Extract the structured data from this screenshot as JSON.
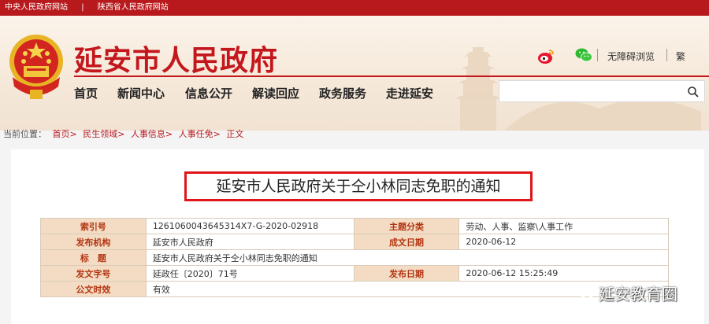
{
  "topbar": {
    "link1": "中央人民政府网站",
    "separator": "|",
    "link2": "陕西省人民政府网站"
  },
  "header": {
    "title": "延安市人民政府",
    "icons": [
      "weibo-icon",
      "wechat-icon"
    ],
    "accessibility": "无障碍浏览",
    "traditional": "繁"
  },
  "nav": [
    "首页",
    "新闻中心",
    "信息公开",
    "解读回应",
    "政务服务",
    "走进延安"
  ],
  "search": {
    "placeholder": ""
  },
  "breadcrumb": {
    "prefix": "当前位置：",
    "items": [
      "首页>",
      "民生领域>",
      "人事信息>",
      "人事任免>",
      "正文"
    ]
  },
  "article": {
    "title": "延安市人民政府关于仝小林同志免职的通知"
  },
  "meta": {
    "rows": [
      [
        "索引号",
        "1261060043645314X7-G-2020-02918",
        "主题分类",
        "劳动、人事、监察\\人事工作"
      ],
      [
        "发布机构",
        "延安市人民政府",
        "成文日期",
        "2020-06-12"
      ],
      [
        "标　题",
        "延安市人民政府关于仝小林同志免职的通知",
        "",
        ""
      ],
      [
        "发文字号",
        "延政任〔2020〕71号",
        "发布日期",
        "2020-06-12 15:25:49"
      ],
      [
        "公文时效",
        "有效",
        "",
        ""
      ]
    ]
  },
  "watermark": {
    "text": "延安教育圈"
  },
  "colors": {
    "brand_red": "#c4171d",
    "topbar": "#b8191d",
    "table_key_bg": "#f3dcc3",
    "table_key_text": "#b33512"
  }
}
